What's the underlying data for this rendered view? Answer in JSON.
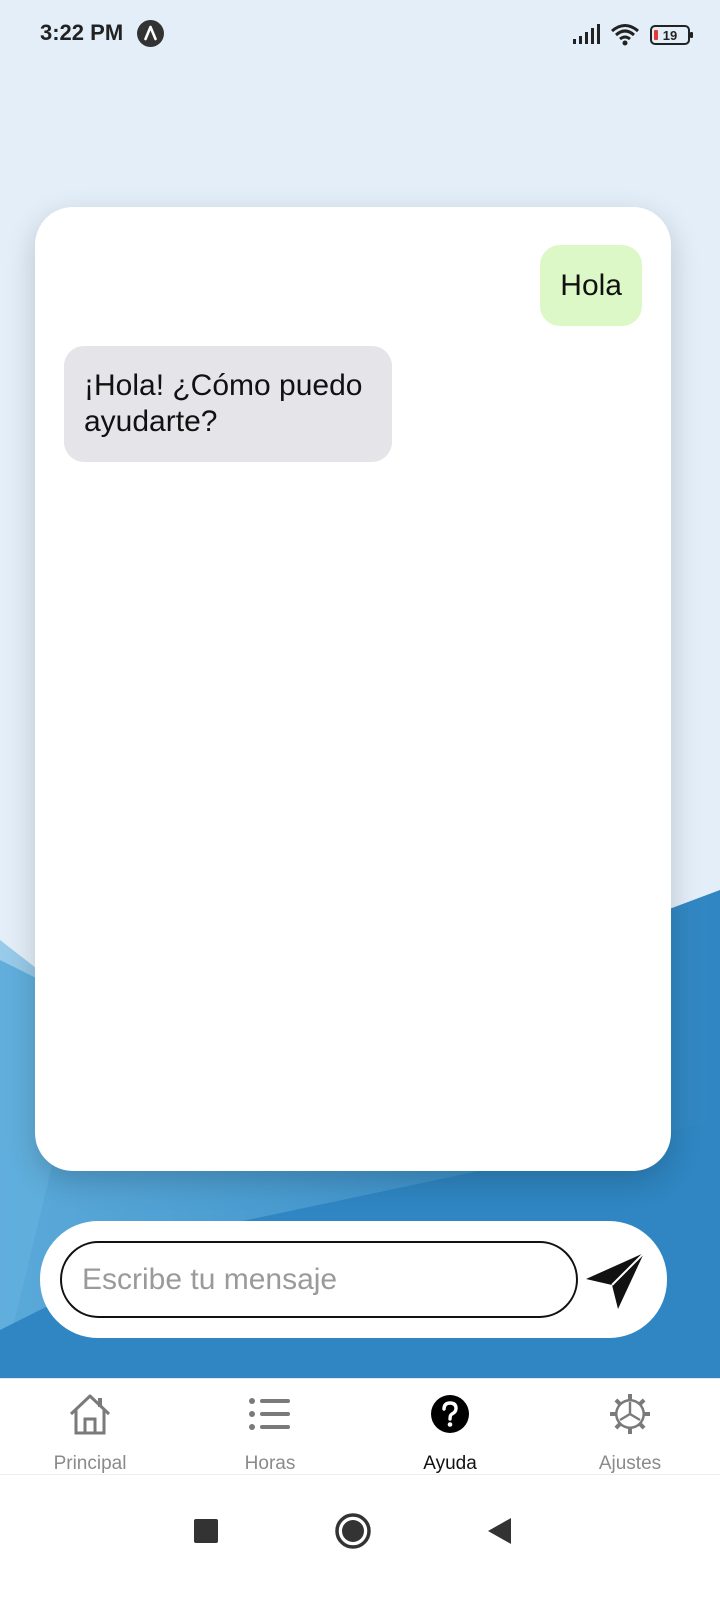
{
  "status_bar": {
    "time": "3:22 PM",
    "battery_level": "19",
    "icons": [
      "signal-icon",
      "wifi-icon",
      "battery-icon"
    ]
  },
  "chat": {
    "messages": [
      {
        "sender": "user",
        "text": "Hola"
      },
      {
        "sender": "bot",
        "text": "¡Hola! ¿Cómo puedo ayudarte?"
      }
    ]
  },
  "input": {
    "placeholder": "Escribe tu mensaje",
    "value": ""
  },
  "nav": {
    "items": [
      {
        "label": "Principal",
        "icon": "home-icon",
        "active": false
      },
      {
        "label": "Horas",
        "icon": "list-icon",
        "active": false
      },
      {
        "label": "Ayuda",
        "icon": "help-icon",
        "active": true
      },
      {
        "label": "Ajustes",
        "icon": "settings-icon",
        "active": false
      }
    ]
  },
  "colors": {
    "background_light": "#e3eef8",
    "background_blue": "#3a8fc7",
    "user_bubble": "#dcf8c6",
    "bot_bubble": "#e4e4e9"
  }
}
